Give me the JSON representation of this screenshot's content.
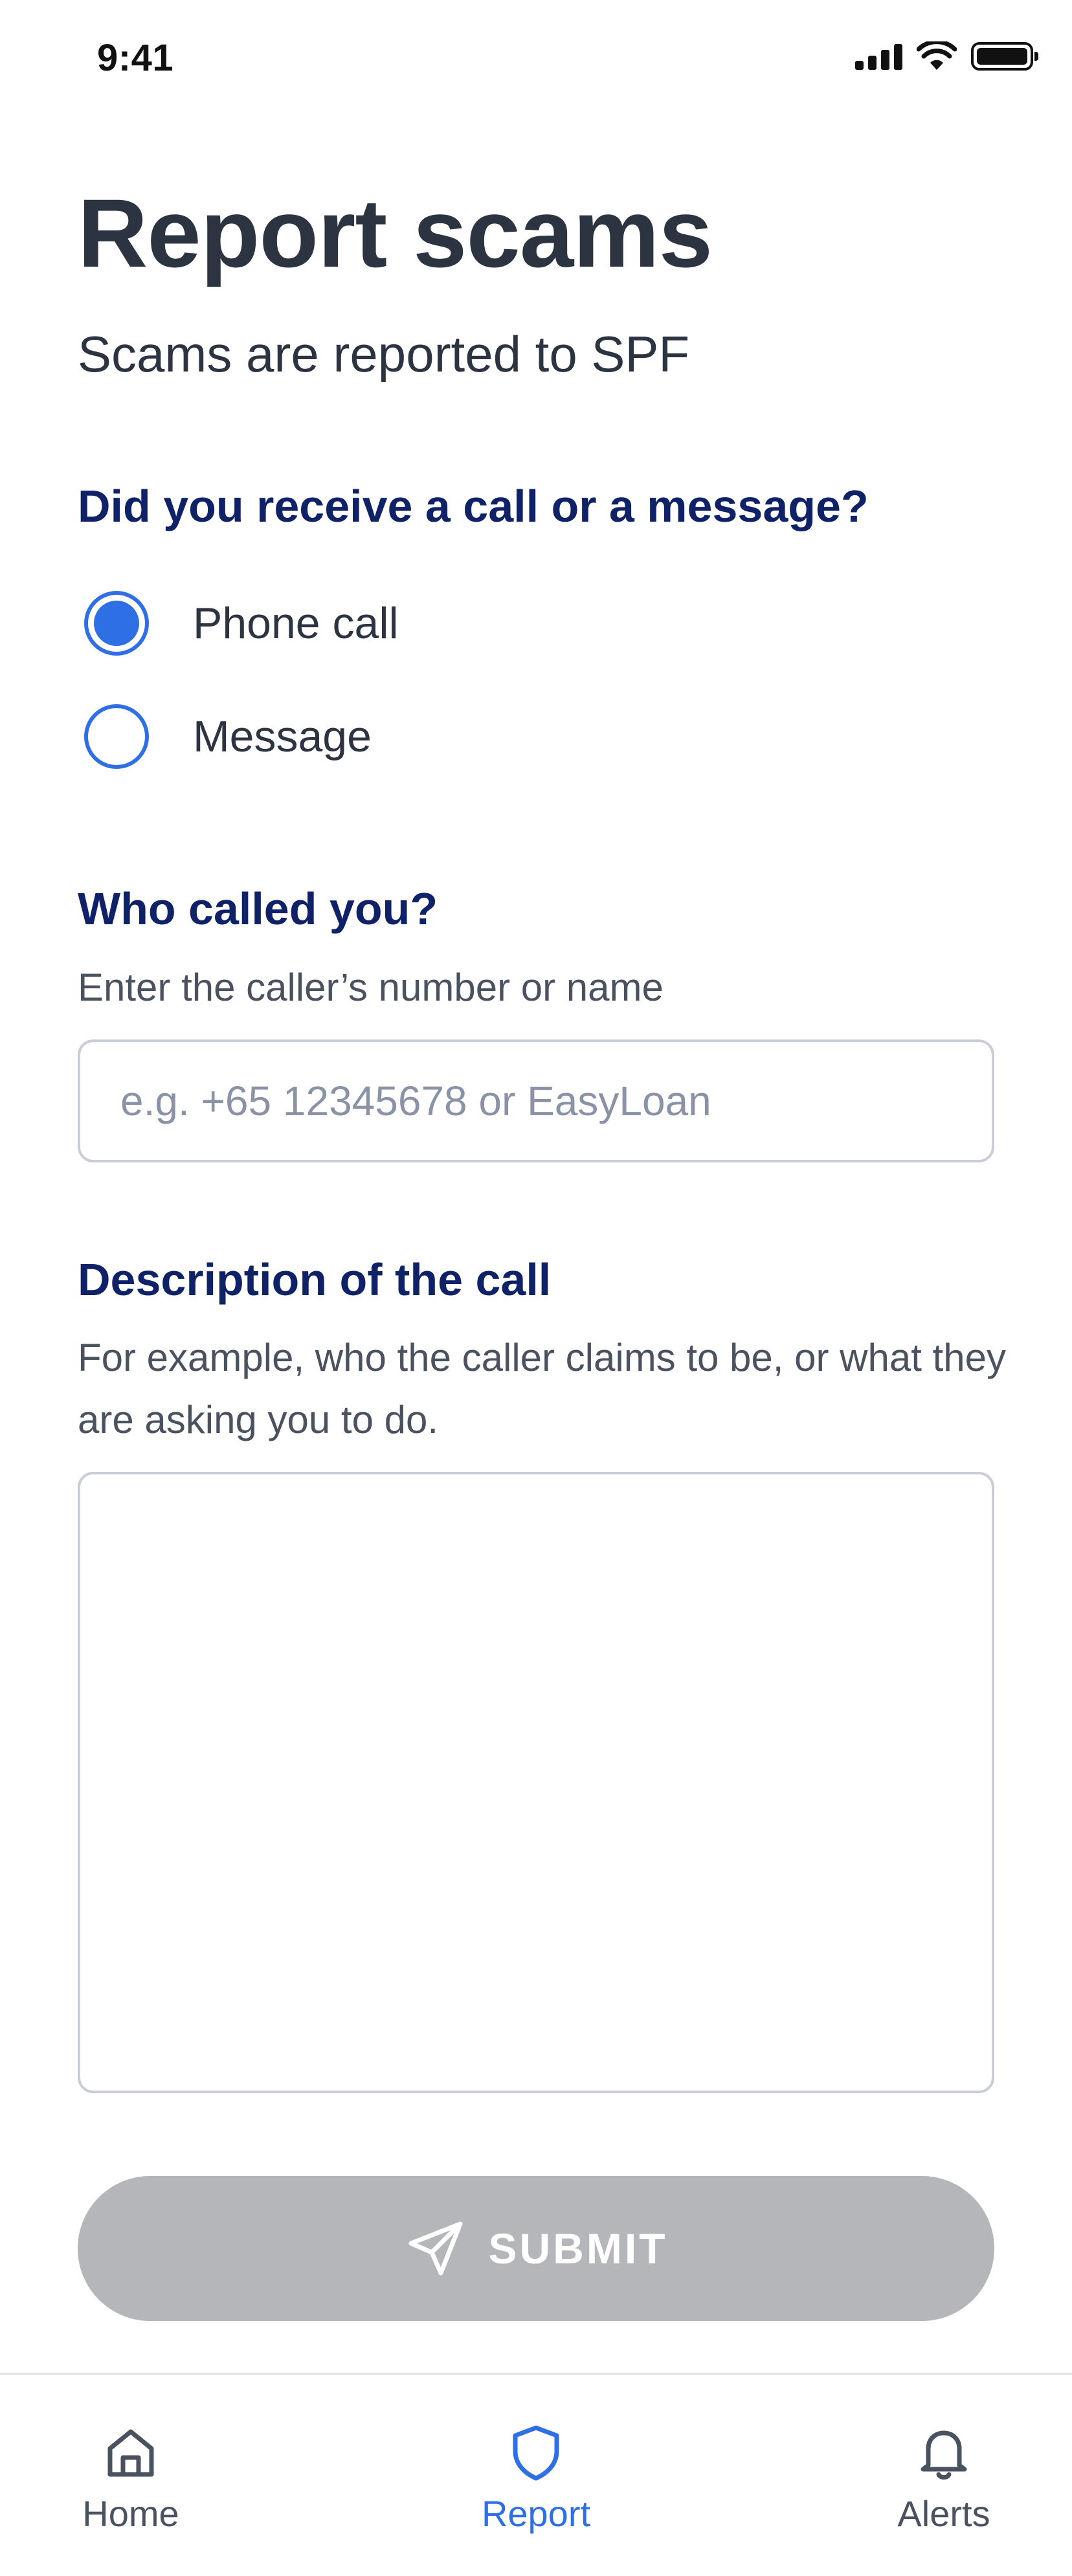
{
  "status_bar": {
    "time": "9:41"
  },
  "header": {
    "title": "Report scams",
    "subtitle": "Scams are reported to SPF"
  },
  "contact_type": {
    "question": "Did you receive a call or a message?",
    "options": [
      {
        "label": "Phone call",
        "selected": true
      },
      {
        "label": "Message",
        "selected": false
      }
    ]
  },
  "caller": {
    "title": "Who called you?",
    "hint": "Enter the caller’s number or name",
    "placeholder": "e.g. +65 12345678 or EasyLoan",
    "value": ""
  },
  "description": {
    "title": "Description of the call",
    "hint": "For example, who the caller claims to be, or what they are asking you to do.",
    "value": ""
  },
  "submit": {
    "label": "SUBMIT",
    "icon": "send-icon",
    "enabled": false
  },
  "tab_bar": {
    "tabs": [
      {
        "label": "Home",
        "icon": "home-icon",
        "active": false
      },
      {
        "label": "Report",
        "icon": "shield-icon",
        "active": true
      },
      {
        "label": "Alerts",
        "icon": "bell-icon",
        "active": false
      }
    ]
  },
  "colors": {
    "accent": "#2f6fe6",
    "heading": "#0f2167",
    "text": "#2d3441",
    "disabled_button": "#b5b6b9"
  }
}
